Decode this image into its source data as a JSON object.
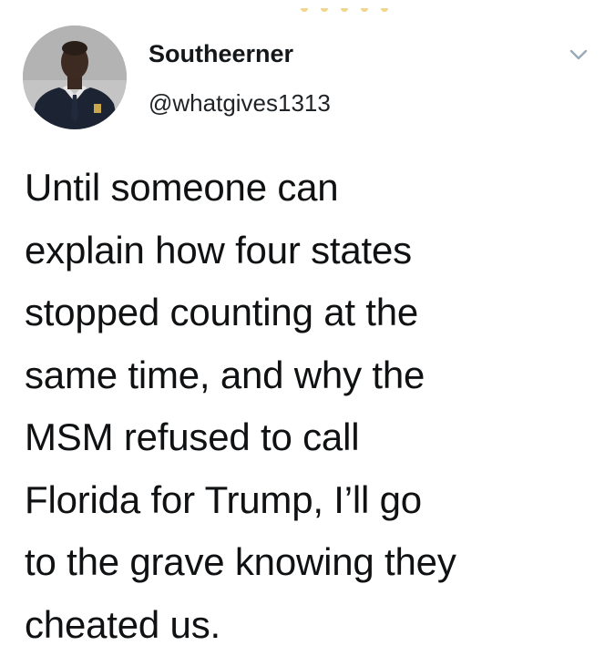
{
  "tweet": {
    "display_name": "Southeerner",
    "handle": "@whatgives1313",
    "text_lines": [
      "Until someone can",
      "explain how four states",
      "stopped counting at the",
      "same time, and why the",
      "MSM refused to call",
      "Florida for Trump, I’ll go",
      "to the grave knowing they",
      "cheated us."
    ],
    "menu_icon": "chevron-down-icon",
    "avatar_icon": "avatar"
  },
  "colors": {
    "text": "#14171a",
    "chevron": "#9aa9b7",
    "background": "#ffffff"
  }
}
